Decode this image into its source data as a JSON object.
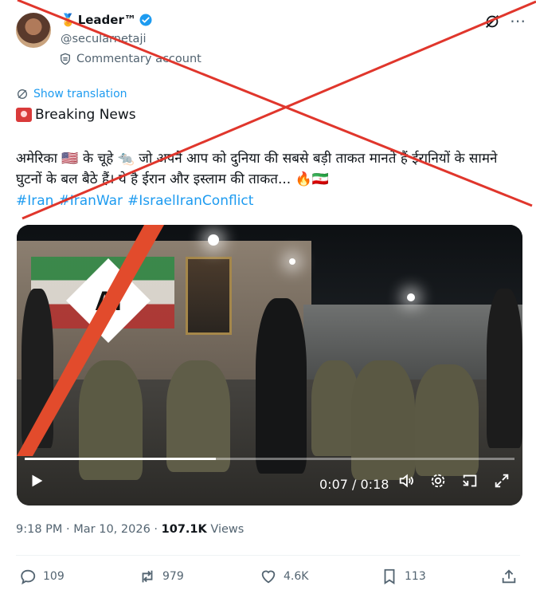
{
  "author": {
    "name": "Leader™",
    "handle": "@secularnetaji",
    "label": "Commentary account"
  },
  "translate_label": "Show translation",
  "breaking_label": "Breaking News",
  "tweet_text": "अमेरिका 🇺🇸 के चूहे 🐀 जो अपने आप को दुनिया की सबसे बड़ी ताकत मानते हैं ईरानियों के सामने घुटनों के बल बैठे हैं। ये है ईरान और इस्लाम की ताकत... 🔥🇮🇷",
  "hashtags": [
    "#Iran",
    "#IranWar",
    "#IsraelIranConflict"
  ],
  "video": {
    "ai_badge": "Ai",
    "time": "0:07 / 0:18",
    "progress": 0.39
  },
  "meta": {
    "time": "9:18 PM",
    "date": "Mar 10, 2026",
    "views_count": "107.1K",
    "views_label": "Views"
  },
  "actions": {
    "replies": "109",
    "reposts": "979",
    "likes": "4.6K",
    "bookmarks": "113"
  },
  "colors": {
    "accent": "#1d9bf0",
    "x_mark": "#e0362c",
    "text_secondary": "#536471"
  },
  "icons": [
    "verified-badge-icon",
    "grok-icon",
    "commentary-shield-icon",
    "translate-icon",
    "siren-icon",
    "play-icon",
    "volume-icon",
    "settings-icon",
    "pip-icon",
    "fullscreen-icon",
    "reply-icon",
    "repost-icon",
    "like-icon",
    "bookmark-icon",
    "share-icon"
  ]
}
